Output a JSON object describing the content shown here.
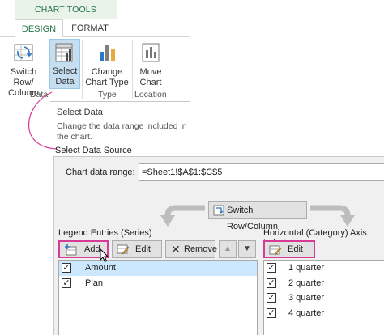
{
  "ribbon": {
    "context_label": "CHART TOOLS",
    "tabs": [
      {
        "label": "DESIGN",
        "active": true
      },
      {
        "label": "FORMAT",
        "active": false
      }
    ],
    "buttons": {
      "switch_row_col": {
        "line1": "Switch Row/",
        "line2": "Column",
        "icon": "switch-row-column-icon"
      },
      "select_data": {
        "line1": "Select",
        "line2": "Data",
        "icon": "select-data-icon"
      },
      "change_chart_type": {
        "line1": "Change",
        "line2": "Chart Type",
        "icon": "change-chart-type-icon"
      },
      "move_chart": {
        "line1": "Move",
        "line2": "Chart",
        "icon": "move-chart-icon"
      }
    },
    "groups": {
      "data": "Data",
      "type": "Type",
      "location": "Location"
    }
  },
  "tooltip": {
    "title": "Select Data",
    "description": "Change the data range included in the chart."
  },
  "dialog": {
    "title": "Select Data Source",
    "range_label": "Chart data range:",
    "range_value": "=Sheet1!$A$1:$C$5",
    "switch_button": "Switch Row/Column",
    "legend": {
      "label": "Legend Entries (Series)",
      "add": "Add",
      "edit": "Edit",
      "remove": "Remove",
      "items": [
        {
          "label": "Amount",
          "checked": true,
          "selected": true
        },
        {
          "label": "Plan",
          "checked": true,
          "selected": false
        }
      ]
    },
    "axis": {
      "label": "Horizontal (Category) Axis Labels",
      "edit": "Edit",
      "items": [
        {
          "label": "1 quarter",
          "checked": true
        },
        {
          "label": "2 quarter",
          "checked": true
        },
        {
          "label": "3 quarter",
          "checked": true
        },
        {
          "label": "4 quarter",
          "checked": true
        }
      ]
    }
  },
  "colors": {
    "accent_green": "#217346",
    "highlight_pink": "#d63c96",
    "selection_blue": "#cce8ff"
  }
}
